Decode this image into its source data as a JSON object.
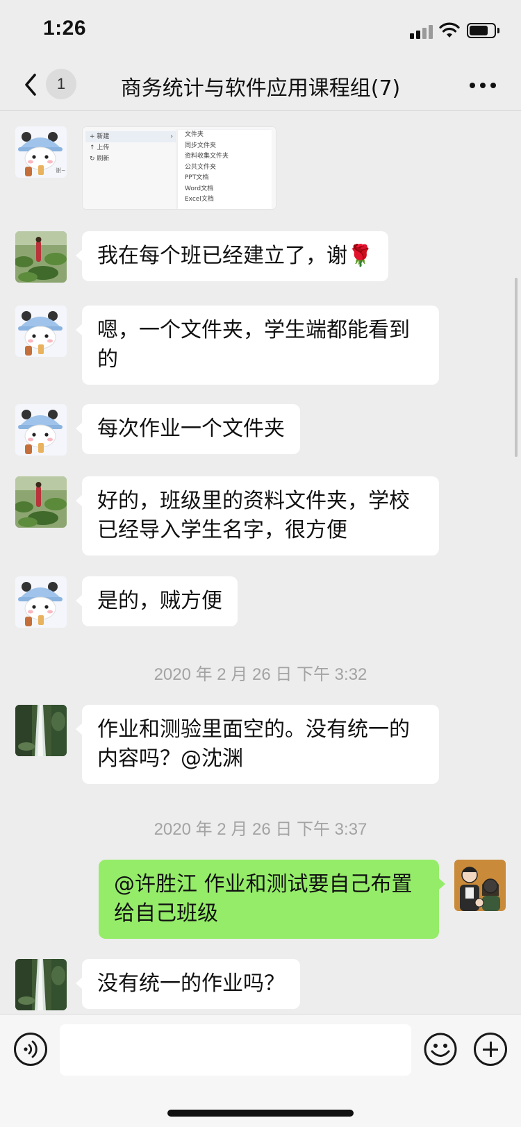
{
  "status_bar": {
    "time": "1:26",
    "icons": [
      "cellular-signal-icon",
      "wifi-icon",
      "battery-icon"
    ],
    "battery_level": 0.75
  },
  "nav": {
    "back_icon": "chevron-left-icon",
    "unread_count": "1",
    "title": "商务统计与软件应用课程组(7)",
    "more_icon": "more-dots-icon"
  },
  "screenshot_message": {
    "menu_left": [
      "新建",
      "上传",
      "刷新"
    ],
    "menu_right": [
      "文件夹",
      "同步文件夹",
      "资料收集文件夹",
      "公共文件夹",
      "PPT文档",
      "Word文档",
      "Excel文档"
    ],
    "avatar_caption": "谢~"
  },
  "messages": [
    {
      "sender": "lotus-user",
      "text": "我在每个班已经建立了，谢🌹"
    },
    {
      "sender": "panda-user",
      "text": "嗯，一个文件夹，学生端都能看到的"
    },
    {
      "sender": "panda-user",
      "text": "每次作业一个文件夹"
    },
    {
      "sender": "lotus-user",
      "text": "好的，班级里的资料文件夹，学校已经导入学生名字，很方便"
    },
    {
      "sender": "panda-user",
      "text": "是的，贼方便"
    },
    {
      "sender": "waterfall-user",
      "text": "作业和测验里面空的。没有统一的内容吗？@沈渊"
    },
    {
      "sender": "self",
      "text": "@许胜江 作业和测试要自己布置给自己班级"
    },
    {
      "sender": "waterfall-user",
      "text": "没有统一的作业吗？"
    }
  ],
  "timestamps": [
    "2020 年 2 月 26 日 下午 3:32",
    "2020 年 2 月 26 日 下午 3:37"
  ],
  "input_bar": {
    "voice_icon": "voice-icon",
    "input_value": "",
    "emoji_icon": "emoji-icon",
    "plus_icon": "plus-icon"
  },
  "colors": {
    "background": "#ededed",
    "self_bubble": "#95ec69",
    "other_bubble": "#ffffff",
    "timestamp_text": "#a3a3a3"
  }
}
